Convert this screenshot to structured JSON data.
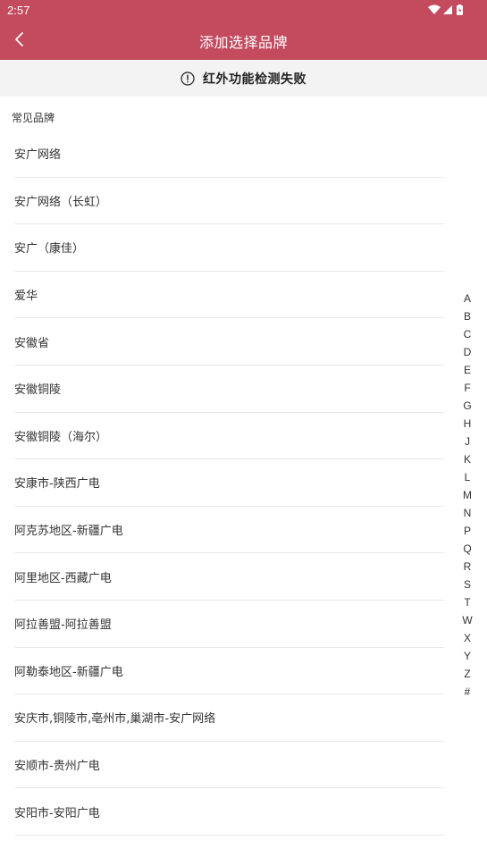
{
  "status_bar": {
    "time": "2:57"
  },
  "app_bar": {
    "title": "添加选择品牌"
  },
  "banner": {
    "message": "红外功能检测失败"
  },
  "section": {
    "label": "常见品牌"
  },
  "brands": [
    "安广网络",
    "安广网络（长虹）",
    "安广（康佳）",
    "爱华",
    "安徽省",
    "安徽铜陵",
    "安徽铜陵（海尔）",
    "安康市-陕西广电",
    "阿克苏地区-新疆广电",
    "阿里地区-西藏广电",
    "阿拉善盟-阿拉善盟",
    "阿勒泰地区-新疆广电",
    "安庆市,铜陵市,亳州市,巢湖市-安广网络",
    "安顺市-贵州广电",
    "安阳市-安阳广电"
  ],
  "index_letters": [
    "A",
    "B",
    "C",
    "D",
    "E",
    "F",
    "G",
    "H",
    "J",
    "K",
    "L",
    "M",
    "N",
    "P",
    "Q",
    "R",
    "S",
    "T",
    "W",
    "X",
    "Y",
    "Z",
    "#"
  ],
  "colors": {
    "header": "#c44a5e",
    "banner_bg": "#f3f3f3"
  },
  "icons": {
    "back": "chevron-left-icon",
    "warning": "exclamation-circle-icon"
  }
}
